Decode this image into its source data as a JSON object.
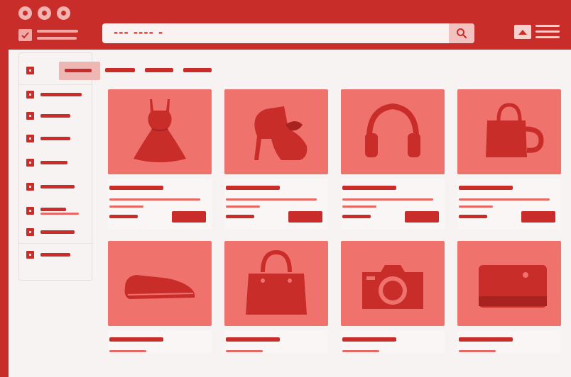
{
  "window": {
    "controls": [
      "close-icon",
      "minimize-icon",
      "maximize-icon"
    ]
  },
  "search": {
    "placeholder": "--- ---- -"
  },
  "icons": {
    "search": "search-icon",
    "user": "image-icon",
    "menu": "hamburger-menu-icon"
  },
  "sidebar": {
    "active_index": 0,
    "items": [
      {
        "state": "active"
      },
      {
        "state": "normal"
      },
      {
        "state": "normal"
      },
      {
        "state": "normal"
      },
      {
        "state": "normal"
      },
      {
        "state": "normal"
      },
      {
        "state": "normal"
      },
      {
        "state": "normal"
      },
      {
        "state": "normal"
      }
    ]
  },
  "tabs": [
    "tab-1",
    "tab-2",
    "tab-3"
  ],
  "products": [
    {
      "icon": "dress-icon"
    },
    {
      "icon": "boot-icon"
    },
    {
      "icon": "headphones-icon"
    },
    {
      "icon": "mug-bag-icon"
    },
    {
      "icon": "shoe-icon"
    },
    {
      "icon": "handbag-icon"
    },
    {
      "icon": "camera-icon"
    },
    {
      "icon": "wallet-icon"
    }
  ],
  "colors": {
    "brand": "#c92d2a",
    "card_image_bg": "#f0726d",
    "page_bg": "#f6f3f2"
  }
}
